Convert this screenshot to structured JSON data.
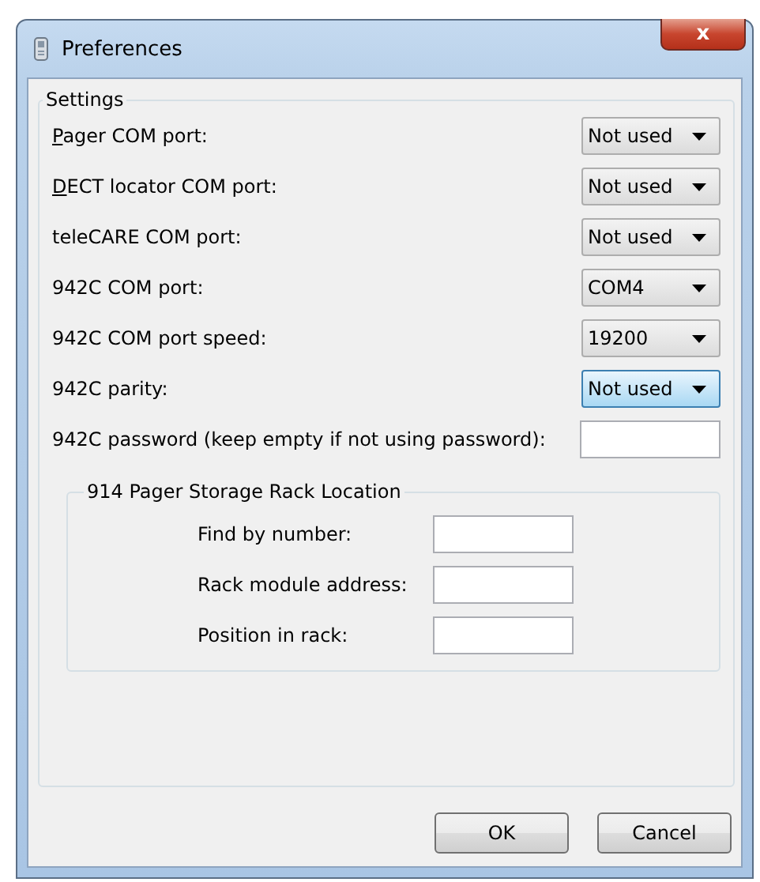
{
  "window": {
    "title": "Preferences",
    "close": "x"
  },
  "settings": {
    "legend": "Settings",
    "rows": [
      {
        "kind": "combo",
        "label": "Pager COM port:",
        "mnemonic": true,
        "value": "Not used",
        "focused": false
      },
      {
        "kind": "combo",
        "label": "DECT locator COM port:",
        "mnemonic": true,
        "value": "Not used",
        "focused": false
      },
      {
        "kind": "combo",
        "label": "teleCARE COM port:",
        "value": "Not used",
        "focused": false
      },
      {
        "kind": "combo",
        "label": "942C COM port:",
        "value": "COM4",
        "focused": false
      },
      {
        "kind": "combo",
        "label": "942C COM port speed:",
        "value": "19200",
        "focused": false
      },
      {
        "kind": "combo",
        "label": "942C parity:",
        "value": "Not used",
        "focused": true
      },
      {
        "kind": "input",
        "label": "942C password (keep empty if not using password):"
      }
    ],
    "rack": {
      "legend": "914 Pager Storage Rack Location",
      "rows": [
        {
          "label": "Find by number:"
        },
        {
          "label": "Rack module address:"
        },
        {
          "label": "Position in rack:"
        }
      ]
    }
  },
  "buttons": [
    {
      "label": "OK"
    },
    {
      "label": "Cancel"
    }
  ]
}
